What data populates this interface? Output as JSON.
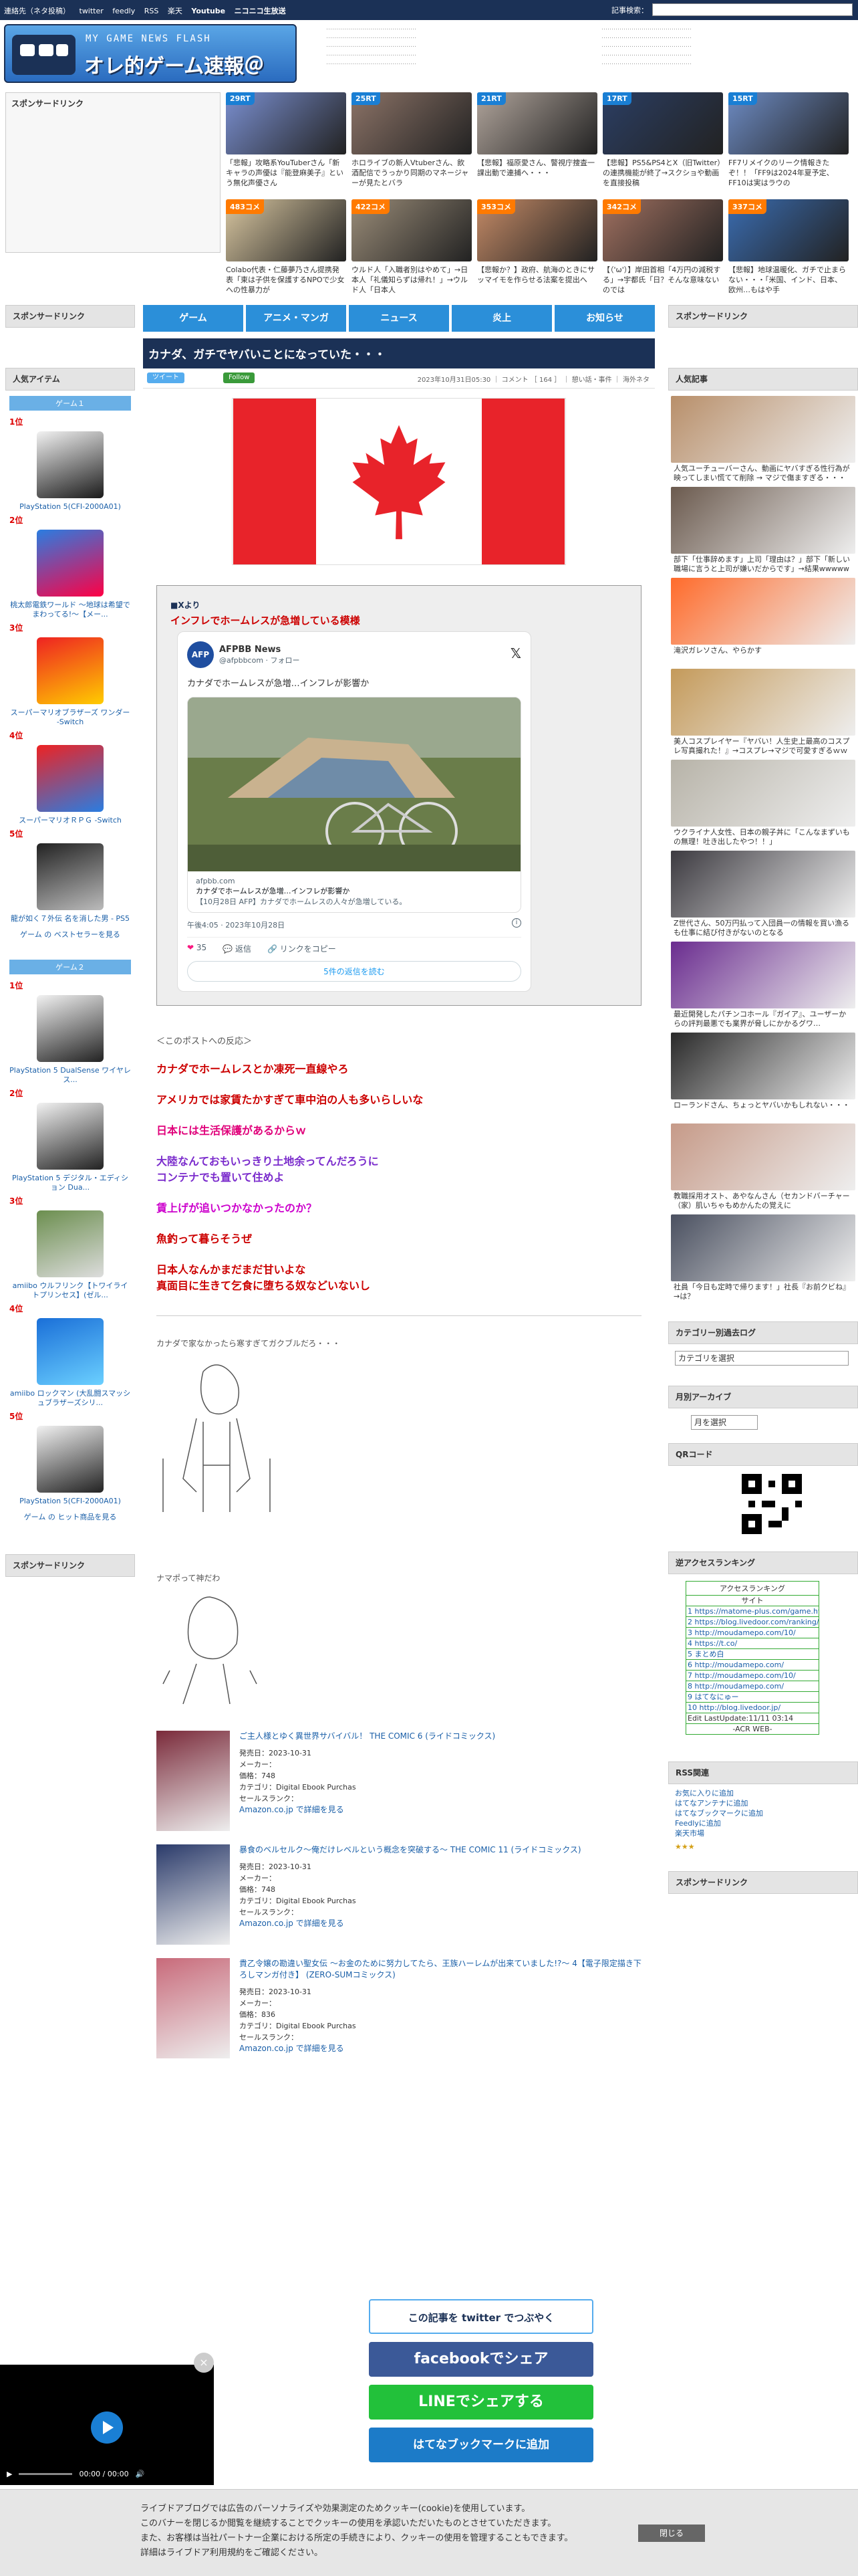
{
  "topbar": {
    "links": [
      "連絡先（ネタ投稿）",
      "twitter",
      "feedly",
      "RSS",
      "楽天",
      "Youtube",
      "ニコニコ生放送"
    ],
    "search_label": "記事検索："
  },
  "banner": {
    "tagline": "MY GAME NEWS FLASH",
    "title": "オレ的ゲーム速報＠JIN"
  },
  "sponsor_label": "スポンサードリンク",
  "tiles_top": [
    {
      "badge": "29RT",
      "caption": "「悲報」攻略系YouTuberさん「新キャラの声優は『能登麻美子』という無化声優さん",
      "color": "#7a8fd0"
    },
    {
      "badge": "25RT",
      "caption": "ホロライブの新人Vtuberさん、飲酒配信でうっかり同期のマネージャーが見たとバラ",
      "color": "#8c7367"
    },
    {
      "badge": "21RT",
      "caption": "【悲報】福原愛さん、警視庁捜査一課出動で連捕へ・・・",
      "color": "#b0a49b"
    },
    {
      "badge": "17RT",
      "caption": "【悲報】PS5&PS4とX（旧Twitter）の連携機能が終了→スクショや動画を直接投稿",
      "color": "#2b3e63"
    },
    {
      "badge": "15RT",
      "caption": "FF7リメイクのリーク情報きたぞ！！「FF9は2024年夏予定、FF10は実はラウの",
      "color": "#6d8bc3"
    }
  ],
  "tiles_bottom": [
    {
      "badge": "483コメ",
      "caption": "Colabo代表・仁藤夢乃さん提携発表「東は子供を保護するNPOで少女への性暴力が",
      "color": "#d8c6a0"
    },
    {
      "badge": "422コメ",
      "caption": "ウルド人「入職者別はやめて」→日本人「礼儀知らずは帰れ！」→ウルド人「日本人",
      "color": "#9a8c78"
    },
    {
      "badge": "353コメ",
      "caption": "【悲報か？】政府、航海のときにサッマイモを作らせる法案を提出へ",
      "color": "#c48a66"
    },
    {
      "badge": "342コメ",
      "caption": "【（'ω'）】岸田首相「4万円の減税する」→宇都氏「日？そんな意味ないのでは",
      "color": "#a07060"
    },
    {
      "badge": "337コメ",
      "caption": "【悲報】地球温暖化、ガチで止まらない・・・「米国、インド、日本、欧州…もはや手",
      "color": "#3a6cb0"
    }
  ],
  "nav": [
    "ゲーム",
    "アニメ・マンガ",
    "ニュース",
    "炎上",
    "お知らせ"
  ],
  "left": {
    "sponsor_label": "スポンサードリンク",
    "popular_label": "人気アイテム",
    "game1_label": "ゲーム１",
    "game1": [
      {
        "rank": "1位",
        "name": "PlayStation 5(CFI-2000A01)"
      },
      {
        "rank": "2位",
        "name": "桃太郎電鉄ワールド ～地球は希望でまわってる!～【メー..."
      },
      {
        "rank": "3位",
        "name": "スーパーマリオブラザーズ ワンダー -Switch"
      },
      {
        "rank": "4位",
        "name": "スーパーマリオＲＰＧ -Switch"
      },
      {
        "rank": "5位",
        "name": "龍が如く７外伝 名を消した男 - PS5"
      }
    ],
    "game1_more": "ゲーム の ベストセラーを見る",
    "game2_label": "ゲーム２",
    "game2": [
      {
        "rank": "1位",
        "name": "PlayStation 5 DualSense ワイヤレス..."
      },
      {
        "rank": "2位",
        "name": "PlayStation 5 デジタル・エディション Dua..."
      },
      {
        "rank": "3位",
        "name": "amiibo ウルフリンク【トワイライトプリンセス】(ゼル..."
      },
      {
        "rank": "4位",
        "name": "amiibo ロックマン (大乱闘スマッシュブラザーズシリ..."
      },
      {
        "rank": "5位",
        "name": "PlayStation 5(CFI-2000A01)"
      }
    ],
    "game2_more": "ゲーム の ヒット商品を見る",
    "bottom_sponsor": "スポンサードリンク"
  },
  "article": {
    "title": "カナダ、ガチでヤバいことになっていた・・・",
    "tweet_btn": "ツイート",
    "follow_btn": "Follow",
    "meta": "2023年10月31日05:30 ｜ コメント ［ 164 ］ ｜ 憩い話・事件 ｜ 海外ネタ",
    "source_label": "■Xより",
    "headline": "インフレでホームレスが急増している模様",
    "tweet": {
      "name": "AFPBB News",
      "handle": "@afpbbcom · フォロー",
      "text": "カナダでホームレスが急増…インフレが影響か",
      "link_domain": "afpbb.com",
      "link_title": "カナダでホームレスが急増…インフレが影響か",
      "link_desc": "【10月28日 AFP】カナダでホームレスの人々が急増している。",
      "time": "午後4:05 · 2023年10月28日",
      "likes": "35",
      "reply_label": "返信",
      "share_label": "リンクをコピー",
      "more_label": "5件の返信を読む"
    },
    "reaction_label": "＜このポストへの反応＞",
    "replies": [
      {
        "text": "カナダでホームレスとか凍死一直線やろ",
        "color": "#cc0000"
      },
      {
        "text": "アメリカでは家賃たかすぎて車中泊の人も多いらしいな",
        "color": "#cc0000"
      },
      {
        "text": "日本には生活保護があるからｗ",
        "color": "#e0007a"
      },
      {
        "text": "大陸なんておもいっきり土地余ってんだろうに\nコンテナでも置いて住めよ",
        "color": "#7a2bcc"
      },
      {
        "text": "賃上げが追いつかなかったのか？",
        "color": "#cc00cc"
      },
      {
        "text": "魚釣って暮らそうぜ",
        "color": "#cc0000"
      },
      {
        "text": "日本人なんかまだまだ甘いよな\n真面目に生きて乞食に堕ちる奴などいないし",
        "color": "#cc0000"
      }
    ],
    "aa_caption1": "カナダで家なかったら寒すぎてガクブルだろ・・・",
    "aa_caption2": "ナマポって神だわ",
    "products": [
      {
        "title": "ご主人様とゆく異世界サバイバル！ THE COMIC 6 (ライドコミックス)",
        "date": "発売日：2023-10-31",
        "maker": "メーカー：",
        "price": "価格：748",
        "category": "カテゴリ：Digital Ebook Purchas",
        "rank": "セールスランク：",
        "link": "Amazon.co.jp で詳細を見る"
      },
      {
        "title": "暴食のベルセルク～俺だけレベルという概念を突破する～ THE COMIC 11 (ライドコミックス)",
        "date": "発売日：2023-10-31",
        "maker": "メーカー：",
        "price": "価格：748",
        "category": "カテゴリ：Digital Ebook Purchas",
        "rank": "セールスランク：",
        "link": "Amazon.co.jp で詳細を見る"
      },
      {
        "title": "貴乙令嬢の勘違い聖女伝 ～お金のために努力してたら、王族ハーレムが出来ていました!?～ 4【電子限定描き下ろしマンガ付き】 (ZERO-SUMコミックス)",
        "date": "発売日：2023-10-31",
        "maker": "メーカー：",
        "price": "価格：836",
        "category": "カテゴリ：Digital Ebook Purchas",
        "rank": "セールスランク：",
        "link": "Amazon.co.jp で詳細を見る"
      }
    ],
    "share": {
      "twitter": "この記事を twitter でつぶやく",
      "facebook": "facebookでシェア",
      "line": "LINEでシェアする",
      "hatena": "はてなブックマークに追加"
    }
  },
  "right": {
    "sponsor_label": "スポンサードリンク",
    "popular_label": "人気記事",
    "popular": [
      {
        "caption": "人気ユーチューバーさん、動画にヤバすぎる性行為が映ってしまい慌てて削除 → マジで傷ますぎる・・・",
        "color": "#b88f6a"
      },
      {
        "caption": "部下「仕事辞めます」上司「理由は？」部下「新しい職場に言うと上司が嫌いだからです」→結果wwwww",
        "color": "#6b5a4e"
      },
      {
        "caption": "滝沢ガレソさん、やらかす",
        "color": "#ff6b2b"
      },
      {
        "caption": "美人コスプレイヤー『ヤバい！人生史上最高のコスプレ写真撮れた！』→コスプレ→マジで可愛すぎるｗｗｗ",
        "color": "#c49a5a"
      },
      {
        "caption": "ウクライナ人女性、日本の親子丼に「こんなまずいもの無理！吐き出したやつ！！」",
        "color": "#b7b3a8"
      },
      {
        "caption": "Z世代さん、50万円払って入団員一の情報を買い漁るも仕事に結び付きがないのとなる",
        "color": "#3c3a40"
      },
      {
        "caption": "最近開発したパチンコホール『ガイア』、ユーザーからの評判最悪でも業界が脅しにかかるグワ…",
        "color": "#6a2c8f"
      },
      {
        "caption": "ローランドさん、ちょっとヤバいかもしれない・・・",
        "color": "#2a2a2a"
      },
      {
        "caption": "教職採用オスト、あやなんさん（セカンドバーチャー（家）肌いちゃもめかんたの覚えに",
        "color": "#c69a88"
      },
      {
        "caption": "社員「今日も定時で帰ります！」社長『お前クビね』→は？",
        "color": "#4a5060"
      }
    ],
    "category_label": "カテゴリー別過去ログ",
    "category_select": "カテゴリを選択",
    "archive_label": "月別アーカイブ",
    "archive_select": "月を選択",
    "qr_label": "QRコード",
    "acr_label": "逆アクセスランキング",
    "acr_title": "アクセスランキング",
    "acr_sub": "サイト",
    "acr_rows": [
      "1 https://matome-plus.com/game.html",
      "2 https://blog.livedoor.com/ranking/",
      "3 http://moudamepo.com/10/",
      "4 https://t.co/",
      "5 まとめ白",
      "6 http://moudamepo.com/",
      "7 http://moudamepo.com/10/",
      "8 http://moudamepo.com/",
      "9 はてなにゅー",
      "10 http://blog.livedoor.jp/"
    ],
    "acr_footer": "Edit LastUpdate:11/11 03:14",
    "acr_brand": "-ACR WEB-",
    "rss_label": "RSS関連",
    "rss_links": [
      "お気に入りに追加",
      "はてなアンテナに追加",
      "はてなブックマークに追加",
      "Feedlyに追加",
      "楽天市場"
    ],
    "bottom_sponsor": "スポンサードリンク"
  },
  "video": {
    "time": "00:00 / 00:00"
  },
  "cookie": {
    "line1": "ライブドアブログでは広告のパーソナライズや効果測定のためクッキー(cookie)を使用しています。",
    "line2": "このバナーを閉じるか閲覧を継続することでクッキーの使用を承認いただいたものとさせていただきます。",
    "line3": "また、お客様は当社パートナー企業における所定の手続きにより、クッキーの使用を管理することもできます。",
    "line4": "詳細はライブドア利用規約をご確認ください。",
    "close": "閉じる"
  }
}
